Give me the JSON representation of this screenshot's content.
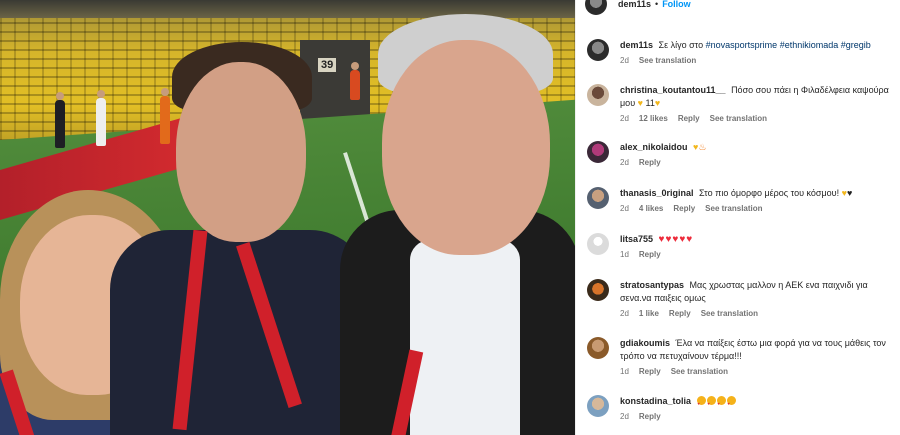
{
  "post": {
    "author": "dem11s",
    "follow_label": "Follow",
    "separator": "•",
    "stadium_sign_number": "39"
  },
  "comments": [
    {
      "username": "dem11s",
      "text": "Σε λίγο στο",
      "hashtags": [
        "#novasportsprime",
        "#ethnikiomada",
        "#gregib"
      ],
      "time": "2d",
      "likes": "",
      "reply_label": "",
      "translate_label": "See translation",
      "avatar_icon": "profile-avatar-icon"
    },
    {
      "username": "christina_koutantou11__",
      "text": "Πόσο σου πάει η Φιλαδέλφεια καψούρα μου",
      "emoji_suffix": "11",
      "time": "2d",
      "likes": "12 likes",
      "reply_label": "Reply",
      "translate_label": "See translation",
      "avatar_icon": "profile-avatar-icon"
    },
    {
      "username": "alex_nikolaidou",
      "text": "",
      "time": "2d",
      "likes": "",
      "reply_label": "Reply",
      "translate_label": "",
      "avatar_icon": "profile-avatar-icon"
    },
    {
      "username": "thanasis_0riginal",
      "text": "Στο πιο όμορφο μέρος του κόσμου!",
      "time": "2d",
      "likes": "4 likes",
      "reply_label": "Reply",
      "translate_label": "See translation",
      "avatar_icon": "profile-avatar-icon"
    },
    {
      "username": "litsa755",
      "text": "",
      "hearts": "♥♥♥♥♥",
      "time": "1d",
      "likes": "",
      "reply_label": "Reply",
      "translate_label": "",
      "avatar_icon": "default-avatar-icon"
    },
    {
      "username": "stratosantypas",
      "text": "Μας χρωστας μαλλον η ΑΕΚ ενα παιχνιδι για σενα.να παιξεις ομως",
      "time": "2d",
      "likes": "1 like",
      "reply_label": "Reply",
      "translate_label": "See translation",
      "avatar_icon": "profile-avatar-icon"
    },
    {
      "username": "gdiakoumis",
      "text": "Έλα να παίξεις έστω μια φορά για να τους μάθεις τον τρόπο να πετυχαίνουν τέρμα!!!",
      "time": "1d",
      "likes": "",
      "reply_label": "Reply",
      "translate_label": "See translation",
      "avatar_icon": "profile-avatar-icon"
    },
    {
      "username": "konstadina_tolia",
      "text": "",
      "time": "2d",
      "likes": "",
      "reply_label": "Reply",
      "translate_label": "",
      "avatar_icon": "profile-avatar-icon"
    }
  ],
  "colors": {
    "link_blue": "#0095f6",
    "hashtag_blue": "#00376b",
    "meta_gray": "#737373",
    "heart_red": "#ed2b3b"
  }
}
